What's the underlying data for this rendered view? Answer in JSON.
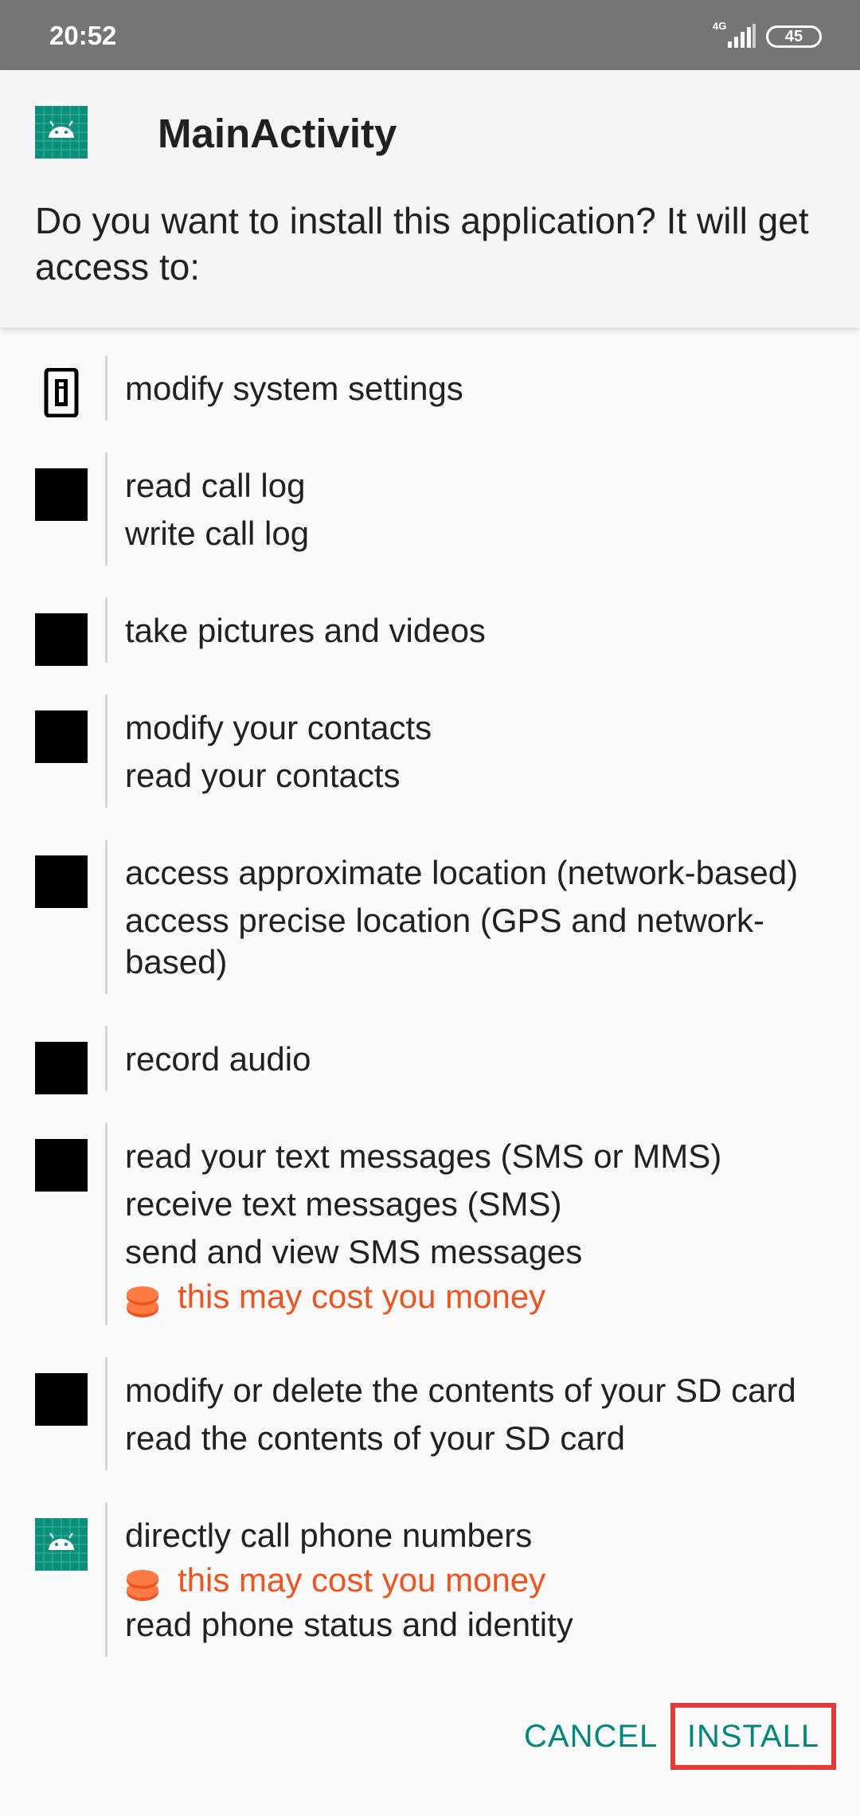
{
  "status_bar": {
    "time": "20:52",
    "network": "4G",
    "battery": "45"
  },
  "header": {
    "app_name": "MainActivity",
    "prompt": "Do you want to install this application? It will get access to:",
    "app_icon": "android-app-icon"
  },
  "permission_groups": [
    {
      "icon": "info-phone-icon",
      "items": [
        "modify system settings"
      ]
    },
    {
      "icon": "call-log-icon",
      "items": [
        "read call log",
        "write call log"
      ]
    },
    {
      "icon": "camera-icon",
      "items": [
        "take pictures and videos"
      ]
    },
    {
      "icon": "contacts-icon",
      "items": [
        "modify your contacts",
        "read your contacts"
      ]
    },
    {
      "icon": "location-icon",
      "items": [
        "access approximate location (network-based)",
        "access precise location (GPS and network-based)"
      ]
    },
    {
      "icon": "microphone-icon",
      "items": [
        "record audio"
      ]
    },
    {
      "icon": "sms-icon",
      "items": [
        "read your text messages (SMS or MMS)",
        "receive text messages (SMS)",
        "send and view SMS messages"
      ],
      "cost": "this may cost you money"
    },
    {
      "icon": "storage-icon",
      "items": [
        "modify or delete the contents of your SD card",
        "read the contents of your SD card"
      ]
    },
    {
      "icon": "android-app-icon",
      "items": [
        "directly call phone numbers"
      ],
      "cost": "this may cost you money",
      "items_after_cost": [
        "read phone status and identity"
      ]
    }
  ],
  "actions": {
    "cancel": "CANCEL",
    "install": "INSTALL"
  },
  "colors": {
    "accent": "#00897b",
    "warning": "#f0541e",
    "highlight": "#e53935",
    "status_bar": "#757575"
  }
}
